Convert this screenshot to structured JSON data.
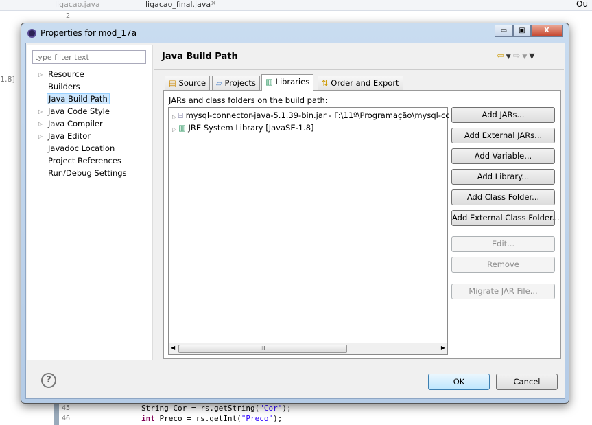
{
  "background": {
    "editor_tabs": [
      "ligacao.java",
      "ligacao_final.java"
    ],
    "outline_label": "Ou",
    "left_fragment": "1.8]",
    "line_numbers": [
      "2",
      "45",
      "46"
    ],
    "code_lines": [
      {
        "type": "String",
        "rest": " Cor = rs.getString(",
        "str": "\"Cor\"",
        "end": ");"
      },
      {
        "type": "int",
        "rest": " Preco = rs.getInt(",
        "str": "\"Preco\"",
        "end": ");"
      }
    ]
  },
  "dialog": {
    "title": "Properties for mod_17a",
    "filter_placeholder": "type filter text",
    "tree": [
      {
        "label": "Resource",
        "expandable": true
      },
      {
        "label": "Builders",
        "expandable": false
      },
      {
        "label": "Java Build Path",
        "expandable": false,
        "selected": true
      },
      {
        "label": "Java Code Style",
        "expandable": true
      },
      {
        "label": "Java Compiler",
        "expandable": true
      },
      {
        "label": "Java Editor",
        "expandable": true
      },
      {
        "label": "Javadoc Location",
        "expandable": false
      },
      {
        "label": "Project References",
        "expandable": false
      },
      {
        "label": "Run/Debug Settings",
        "expandable": false
      }
    ],
    "page_title": "Java Build Path",
    "tabs": [
      "Source",
      "Projects",
      "Libraries",
      "Order and Export"
    ],
    "active_tab": "Libraries",
    "list_label": "JARs and class folders on the build path:",
    "entries": [
      "mysql-connector-java-5.1.39-bin.jar - F:\\11º\\Programação\\mysql-cc",
      "JRE System Library [JavaSE-1.8]"
    ],
    "buttons": [
      {
        "label": "Add JARs...",
        "enabled": true
      },
      {
        "label": "Add External JARs...",
        "enabled": true
      },
      {
        "label": "Add Variable...",
        "enabled": true
      },
      {
        "label": "Add Library...",
        "enabled": true
      },
      {
        "label": "Add Class Folder...",
        "enabled": true
      },
      {
        "label": "Add External Class Folder...",
        "enabled": true
      },
      {
        "label": "Edit...",
        "enabled": false
      },
      {
        "label": "Remove",
        "enabled": false
      },
      {
        "label": "Migrate JAR File...",
        "enabled": false
      }
    ],
    "scroll_thumb": "III",
    "ok": "OK",
    "cancel": "Cancel",
    "help": "?"
  }
}
